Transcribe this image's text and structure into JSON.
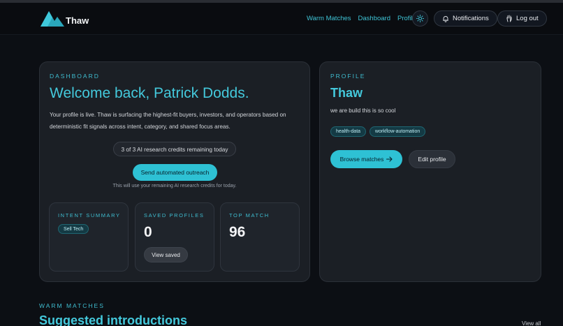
{
  "brand": {
    "name": "Thaw"
  },
  "nav": {
    "links": [
      "Warm Matches",
      "Dashboard",
      "Profile"
    ],
    "theme_icon": "sun-icon",
    "notifications_label": "Notifications",
    "notifications_icon": "bell-icon",
    "logout_label": "Log out",
    "logout_icon": "hand-icon"
  },
  "dashboard": {
    "eyebrow": "DASHBOARD",
    "title": "Welcome back, Patrick Dodds.",
    "body": "Your profile is live. Thaw is surfacing the highest-fit buyers, investors, and operators based on deterministic fit signals across intent, category, and shared focus areas.",
    "credits": "3 of 3 AI research credits remaining today",
    "outreach_button": "Send automated outreach",
    "outreach_note": "This will use your remaining AI research credits for today.",
    "intent_summary": {
      "label": "INTENT SUMMARY",
      "tag": "Sell Tech"
    },
    "saved_profiles": {
      "label": "SAVED PROFILES",
      "value": "0",
      "button": "View saved"
    },
    "top_match": {
      "label": "TOP MATCH",
      "value": "96"
    }
  },
  "profile": {
    "eyebrow": "PROFILE",
    "title": "Thaw",
    "description": "we are build this is so cool",
    "tags": [
      "health-data",
      "workflow-automation"
    ],
    "browse_button": "Browse matches",
    "browse_icon": "arrow-right-icon",
    "edit_button": "Edit profile"
  },
  "warm_matches": {
    "eyebrow": "WARM MATCHES",
    "title": "Suggested introductions",
    "view_all": "View all"
  },
  "colors": {
    "accent": "#2ec1d4",
    "accent_text": "#44c9dc",
    "background": "#0c0f14",
    "card": "#1b1f25"
  }
}
